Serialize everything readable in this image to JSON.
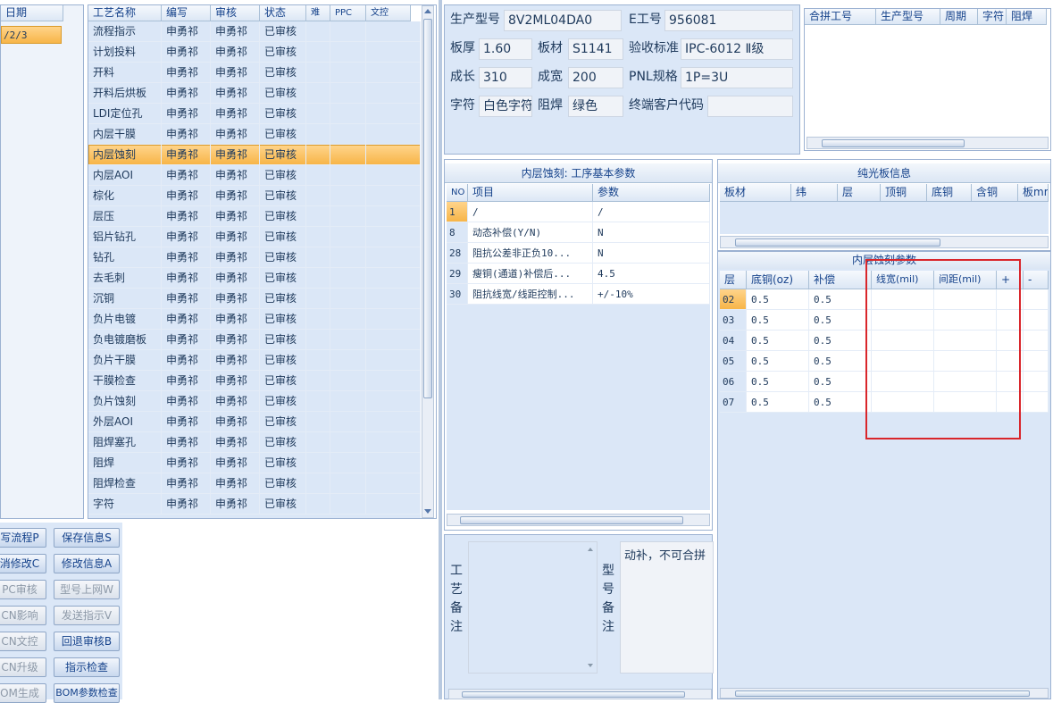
{
  "left_panel": {
    "header": "日期",
    "selected_value": "/2/3"
  },
  "process_grid": {
    "columns": [
      "工艺名称",
      "编写",
      "审核",
      "状态",
      "难",
      "PPC",
      "文控"
    ],
    "rows": [
      {
        "name": "流程指示",
        "writer": "申勇祁",
        "reviewer": "申勇祁",
        "status": "已审核"
      },
      {
        "name": "计划投料",
        "writer": "申勇祁",
        "reviewer": "申勇祁",
        "status": "已审核"
      },
      {
        "name": "开料",
        "writer": "申勇祁",
        "reviewer": "申勇祁",
        "status": "已审核"
      },
      {
        "name": "开料后烘板",
        "writer": "申勇祁",
        "reviewer": "申勇祁",
        "status": "已审核"
      },
      {
        "name": "LDI定位孔",
        "writer": "申勇祁",
        "reviewer": "申勇祁",
        "status": "已审核"
      },
      {
        "name": "内层干膜",
        "writer": "申勇祁",
        "reviewer": "申勇祁",
        "status": "已审核"
      },
      {
        "name": "内层蚀刻",
        "writer": "申勇祁",
        "reviewer": "申勇祁",
        "status": "已审核"
      },
      {
        "name": "内层AOI",
        "writer": "申勇祁",
        "reviewer": "申勇祁",
        "status": "已审核"
      },
      {
        "name": "棕化",
        "writer": "申勇祁",
        "reviewer": "申勇祁",
        "status": "已审核"
      },
      {
        "name": "层压",
        "writer": "申勇祁",
        "reviewer": "申勇祁",
        "status": "已审核"
      },
      {
        "name": "铝片钻孔",
        "writer": "申勇祁",
        "reviewer": "申勇祁",
        "status": "已审核"
      },
      {
        "name": "钻孔",
        "writer": "申勇祁",
        "reviewer": "申勇祁",
        "status": "已审核"
      },
      {
        "name": "去毛刺",
        "writer": "申勇祁",
        "reviewer": "申勇祁",
        "status": "已审核"
      },
      {
        "name": "沉铜",
        "writer": "申勇祁",
        "reviewer": "申勇祁",
        "status": "已审核"
      },
      {
        "name": "负片电镀",
        "writer": "申勇祁",
        "reviewer": "申勇祁",
        "status": "已审核"
      },
      {
        "name": "负电镀磨板",
        "writer": "申勇祁",
        "reviewer": "申勇祁",
        "status": "已审核"
      },
      {
        "name": "负片干膜",
        "writer": "申勇祁",
        "reviewer": "申勇祁",
        "status": "已审核"
      },
      {
        "name": "干膜检查",
        "writer": "申勇祁",
        "reviewer": "申勇祁",
        "status": "已审核"
      },
      {
        "name": "负片蚀刻",
        "writer": "申勇祁",
        "reviewer": "申勇祁",
        "status": "已审核"
      },
      {
        "name": "外层AOI",
        "writer": "申勇祁",
        "reviewer": "申勇祁",
        "status": "已审核"
      },
      {
        "name": "阻焊塞孔",
        "writer": "申勇祁",
        "reviewer": "申勇祁",
        "status": "已审核"
      },
      {
        "name": "阻焊",
        "writer": "申勇祁",
        "reviewer": "申勇祁",
        "status": "已审核"
      },
      {
        "name": "阻焊检查",
        "writer": "申勇祁",
        "reviewer": "申勇祁",
        "status": "已审核"
      },
      {
        "name": "字符",
        "writer": "申勇祁",
        "reviewer": "申勇祁",
        "status": "已审核"
      }
    ]
  },
  "buttons": {
    "left": [
      "写流程P",
      "消修改C",
      "PC审核",
      "CN影响",
      "CN文控",
      "CN升级",
      "OM生成"
    ],
    "right": [
      "保存信息S",
      "修改信息A",
      "型号上网W",
      "发送指示V",
      "回退审核B",
      "指示检查",
      "BOM参数检查"
    ]
  },
  "product_info": {
    "model_label": "生产型号",
    "model_value": "8V2ML04DA0",
    "eno_label": "E工号",
    "eno_value": "956081",
    "thickness_label": "板厚",
    "thickness_value": "1.60",
    "material_label": "板材",
    "material_value": "S1141",
    "standard_label": "验收标准",
    "standard_value": "IPC-6012 Ⅱ级",
    "length_label": "成长",
    "length_value": "310",
    "width_label": "成宽",
    "width_value": "200",
    "pnl_label": "PNL规格",
    "pnl_value": "1P=3U",
    "char_label": "字符",
    "char_value": "白色字符",
    "mask_label": "阻焊",
    "mask_value": "绿色",
    "customer_label": "终端客户代码",
    "customer_value": ""
  },
  "merge_grid": {
    "columns": [
      "合拼工号",
      "生产型号",
      "周期",
      "字符",
      "阻焊"
    ]
  },
  "params_panel": {
    "title": "内层蚀刻: 工序基本参数",
    "columns": [
      "NO",
      "项目",
      "参数"
    ],
    "rows": [
      {
        "no": "1",
        "item": "/",
        "param": "/"
      },
      {
        "no": "8",
        "item": "动态补偿(Y/N)",
        "param": "N"
      },
      {
        "no": "28",
        "item": "阻抗公差非正负10...",
        "param": "N"
      },
      {
        "no": "29",
        "item": "瘦铜(通道)补偿后...",
        "param": "4.5"
      },
      {
        "no": "30",
        "item": "阻抗线宽/线距控制...",
        "param": "+/-10%"
      }
    ]
  },
  "bare_board": {
    "title": "纯光板信息",
    "columns": [
      "板材",
      "纬",
      "层",
      "顶铜",
      "底铜",
      "含铜",
      "板mm"
    ]
  },
  "etch_params": {
    "title": "内层蚀刻参数",
    "columns": [
      "层",
      "底铜(oz)",
      "补偿",
      "线宽(mil)",
      "间距(mil)",
      "+",
      "-"
    ],
    "rows": [
      {
        "layer": "02",
        "copper": "0.5",
        "comp": "0.5"
      },
      {
        "layer": "03",
        "copper": "0.5",
        "comp": "0.5"
      },
      {
        "layer": "04",
        "copper": "0.5",
        "comp": "0.5"
      },
      {
        "layer": "05",
        "copper": "0.5",
        "comp": "0.5"
      },
      {
        "layer": "06",
        "copper": "0.5",
        "comp": "0.5"
      },
      {
        "layer": "07",
        "copper": "0.5",
        "comp": "0.5"
      }
    ]
  },
  "remarks": {
    "process_label": "工艺备注",
    "model_label": "型号备注",
    "model_text": "动补，不可合拼"
  },
  "colors": {
    "panel": "#dbe7f7",
    "selection": "#f7b548",
    "header_text": "#15428b",
    "highlight_box": "#d9262b"
  }
}
